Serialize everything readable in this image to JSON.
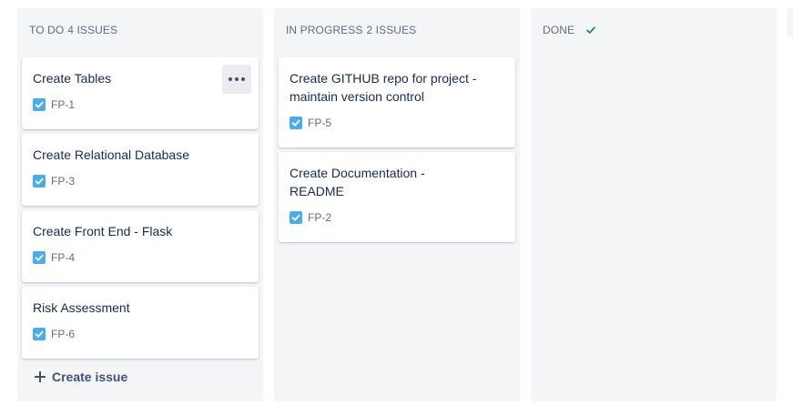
{
  "colors": {
    "column_bg": "#f4f5f7",
    "header_text": "#5e6c84",
    "card_text": "#172b4d",
    "task_icon": "#4bade8",
    "done_check": "#00875a"
  },
  "columns": [
    {
      "title": "TO DO",
      "count": "4 ISSUES",
      "cards": [
        {
          "summary": "Create Tables",
          "key": "FP-1",
          "icon": "task-icon"
        },
        {
          "summary": "Create Relational Database",
          "key": "FP-3",
          "icon": "task-icon"
        },
        {
          "summary": "Create Front End - Flask",
          "key": "FP-4",
          "icon": "task-icon"
        },
        {
          "summary": "Risk Assessment",
          "key": "FP-6",
          "icon": "task-icon"
        }
      ],
      "create_label": "Create issue"
    },
    {
      "title": "IN PROGRESS",
      "count": "2 ISSUES",
      "cards": [
        {
          "summary": "Create GITHUB repo for project - maintain version control",
          "key": "FP-5",
          "icon": "task-icon"
        },
        {
          "summary": "Create Documentation - README",
          "key": "FP-2",
          "icon": "task-icon"
        }
      ]
    },
    {
      "title": "DONE",
      "icon": "check-icon",
      "cards": []
    }
  ]
}
